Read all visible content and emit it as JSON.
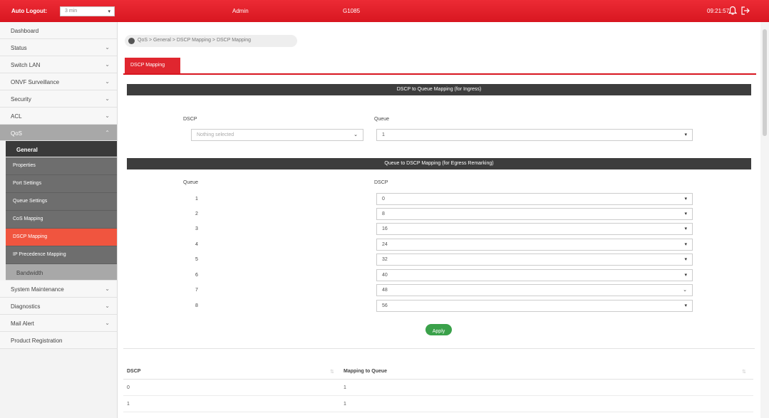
{
  "header": {
    "auto_logout_label": "Auto Logout:",
    "auto_logout_value": "3 min",
    "user": "Admin",
    "model": "G1085",
    "clock": "09:21:57",
    "bell_icon": "bell-icon",
    "logout_icon": "logout-icon",
    "accent_color": "#d81620"
  },
  "sidebar": {
    "items": [
      {
        "label": "Dashboard"
      },
      {
        "label": "Status"
      },
      {
        "label": "Switch LAN"
      },
      {
        "label": "ONVF Surveillance"
      },
      {
        "label": "Security"
      },
      {
        "label": "ACL"
      },
      {
        "label": "QoS"
      }
    ],
    "general_label": "General",
    "sub_items": [
      {
        "label": "Properties"
      },
      {
        "label": "Port Settings"
      },
      {
        "label": "Queue Settings"
      },
      {
        "label": "CoS Mapping"
      },
      {
        "label": "DSCP Mapping"
      },
      {
        "label": "IP Precedence Mapping"
      }
    ],
    "bandwidth_label": "Bandwidth",
    "bottom_items": [
      {
        "label": "System Maintenance"
      },
      {
        "label": "Diagnostics"
      },
      {
        "label": "Mail Alert"
      },
      {
        "label": "Product Registration"
      }
    ]
  },
  "breadcrumb": "QoS > General > DSCP Mapping > DSCP Mapping",
  "tab": "DSCP Mapping",
  "ingress": {
    "title": "DSCP to Queue Mapping (for Ingress)",
    "dscp_label": "DSCP",
    "queue_label": "Queue",
    "dscp_placeholder": "Nothing selected",
    "queue_value": "1"
  },
  "egress": {
    "title": "Queue to DSCP Mapping (for Egress Remarking)",
    "queue_label": "Queue",
    "dscp_label": "DSCP",
    "rows": [
      {
        "queue": "1",
        "dscp": "0"
      },
      {
        "queue": "2",
        "dscp": "8"
      },
      {
        "queue": "3",
        "dscp": "16"
      },
      {
        "queue": "4",
        "dscp": "24"
      },
      {
        "queue": "5",
        "dscp": "32"
      },
      {
        "queue": "6",
        "dscp": "40"
      },
      {
        "queue": "7",
        "dscp": "48"
      },
      {
        "queue": "8",
        "dscp": "56"
      }
    ]
  },
  "apply_label": "Apply",
  "apply_color": "#3aa14a",
  "table": {
    "headers": [
      "DSCP",
      "Mapping to Queue"
    ],
    "rows": [
      [
        "0",
        "1"
      ],
      [
        "1",
        "1"
      ]
    ]
  }
}
